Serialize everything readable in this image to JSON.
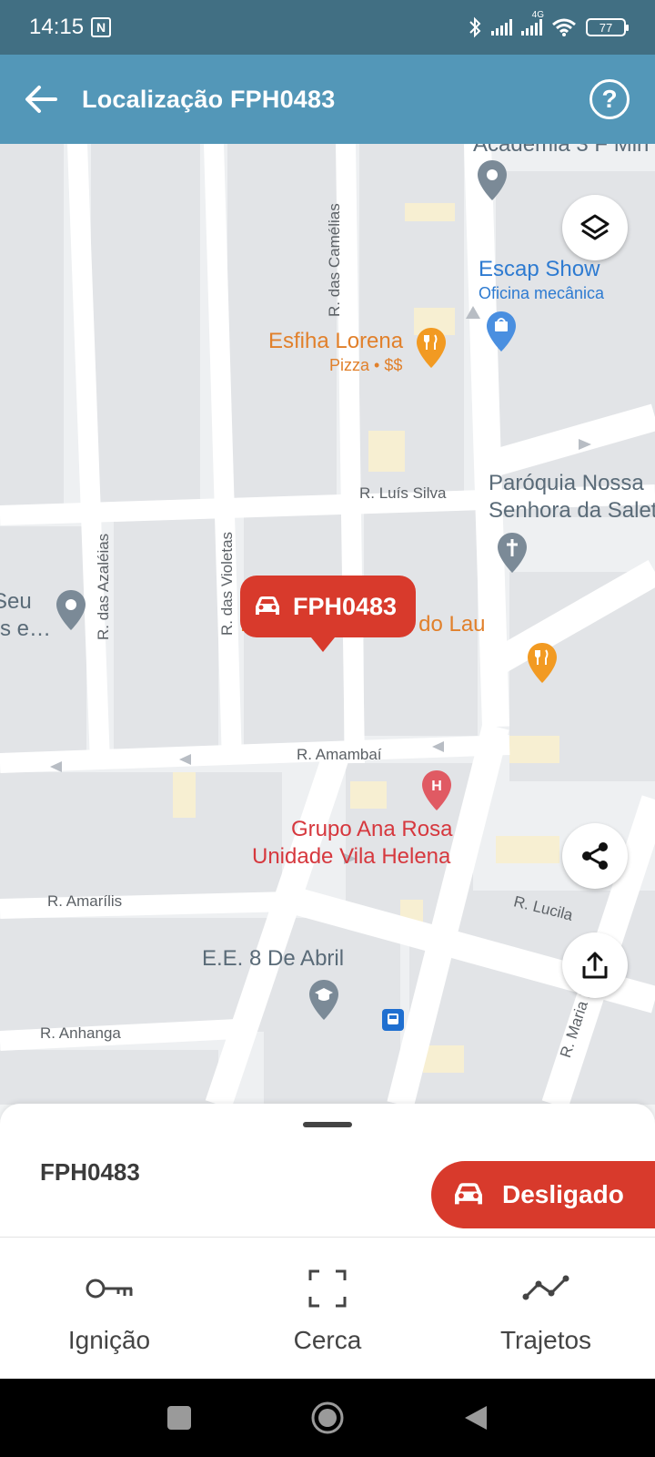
{
  "status_bar": {
    "time": "14:15",
    "network": "4G",
    "battery": "77"
  },
  "app_bar": {
    "title": "Localização FPH0483"
  },
  "map": {
    "streets": {
      "camelias": "R. das Camélias",
      "luis_silva": "R. Luís Silva",
      "azaleias": "R. das Azaléias",
      "violetas": "R. das Violetas",
      "amambai": "R. Amambaí",
      "amarilis": "R. Amarílis",
      "lucila": "R. Lucila",
      "anhanga": "R. Anhanga",
      "maria": "R. Maria H"
    },
    "pois": {
      "academia": "Academia 3 F Min",
      "escap_name": "Escap Show",
      "escap_type": "Oficina mecânica",
      "esfiha_name": "Esfiha Lorena",
      "esfiha_type": "Pizza • $$",
      "paroquia_line1": "Paróquia Nossa",
      "paroquia_line2": "Senhora da Salet",
      "seu_line1": "Seu",
      "seu_line2": "s e…",
      "restaurante": "Restaurante Jabá do Lau",
      "grupo_line1": "Grupo Ana Rosa",
      "grupo_line2": "Unidade Vila Helena",
      "escola": "E.E. 8 De Abril"
    },
    "vehicle_marker": "FPH0483"
  },
  "sheet": {
    "plate": "FPH0483",
    "status": "Desligado",
    "actions": [
      {
        "label": "Ignição",
        "icon": "key-icon"
      },
      {
        "label": "Cerca",
        "icon": "fence-icon"
      },
      {
        "label": "Trajetos",
        "icon": "route-icon"
      }
    ]
  },
  "colors": {
    "app_bar": "#5397b8",
    "status_bar": "#416f83",
    "accent_red": "#d83a2c"
  }
}
